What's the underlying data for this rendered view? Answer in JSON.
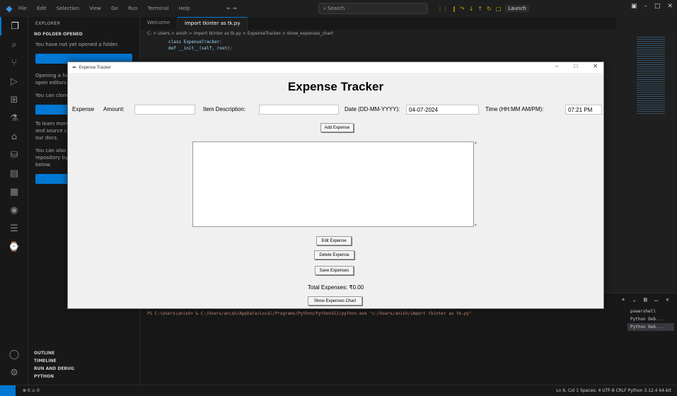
{
  "vscode": {
    "menu": [
      "File",
      "Edit",
      "Selection",
      "View",
      "Go",
      "Run",
      "Terminal",
      "Help"
    ],
    "search_placeholder": "Search",
    "launch_label": "Launch",
    "tabs": [
      "Welcome",
      "import tkinter as tk.py"
    ],
    "breadcrumb": "C: > Users > anish > import tkinter as tk.py > ExpenseTracker > show_expenses_chart",
    "code_lines": [
      "class ExpenseTracker:",
      "    def __init__(self, root):"
    ],
    "sidebar": {
      "title": "EXPLORER",
      "section": "NO FOLDER OPENED",
      "msg1": "You have not yet opened a folder.",
      "msg2": "Opening a folder will close all currently open editors.",
      "msg3": "You can clone a repository locally.",
      "msg4": "To learn more about how to use Git and source control in VS Code read our docs.",
      "msg5": "You can also open a folder, or clone a repository by clicking the button below.",
      "bottom": [
        "OUTLINE",
        "TIMELINE",
        "RUN AND DEBUG",
        "PYTHON"
      ]
    },
    "terminal_line": "PS C:\\Users\\anish> & C:/Users/anish/AppData/Local/Programs/Python/Python312/python.exe \"c:/Users/anish/import tkinter as tk.py\"",
    "terminal_list": [
      "powershell",
      "Python Deb...",
      "Python Deb..."
    ],
    "status_left": "⊗ 0 ⚠ 0",
    "status_right": "Ln 6, Col 1  Spaces: 4  UTF-8  CRLF  Python 3.12.4 64-bit"
  },
  "app": {
    "window_title": "Expense Tracker",
    "heading": "Expense Tracker",
    "expense_label": "Expense",
    "amount_label": "Amount:",
    "amount_value": "",
    "desc_label": "Item Description:",
    "desc_value": "",
    "date_label": "Date (DD-MM-YYYY):",
    "date_value": "04-07-2024",
    "time_label": "Time (HH:MM AM/PM):",
    "time_value": "07:21 PM",
    "add_button": "Add Expense",
    "edit_button": "Edit Expense",
    "delete_button": "Delete Expense",
    "save_button": "Save Expenses",
    "chart_button": "Show Expenses Chart",
    "total_label": "Total Expenses: ₹0.00"
  }
}
